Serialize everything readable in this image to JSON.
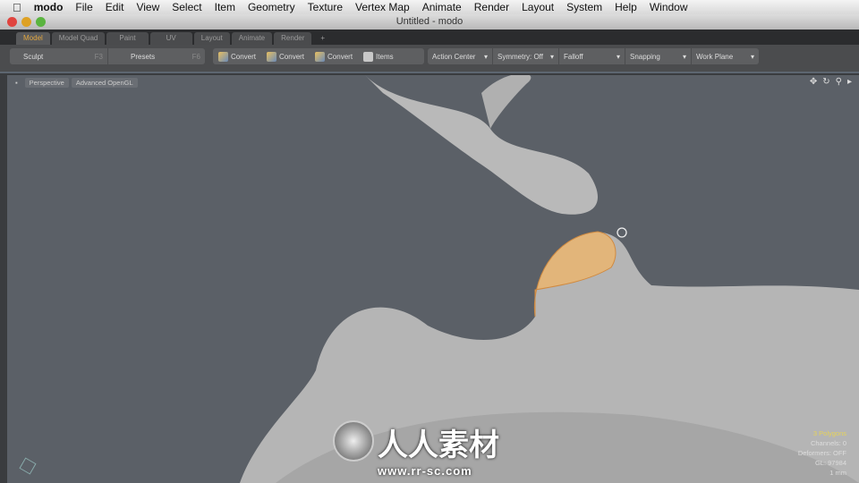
{
  "menubar": {
    "app": "modo",
    "items": [
      "File",
      "Edit",
      "View",
      "Select",
      "Item",
      "Geometry",
      "Texture",
      "Vertex Map",
      "Animate",
      "Render",
      "Layout",
      "System",
      "Help",
      "Window"
    ]
  },
  "window": {
    "title": "Untitled - modo"
  },
  "tabs": [
    {
      "label": "Model",
      "active": true
    },
    {
      "label": "Model Quad"
    },
    {
      "label": "Paint"
    },
    {
      "label": "UV"
    },
    {
      "label": "Layout"
    },
    {
      "label": "Animate"
    },
    {
      "label": "Render"
    },
    {
      "label": "+"
    }
  ],
  "toolbar": {
    "sculpt": "Sculpt",
    "sculpt_key": "F3",
    "presets": "Presets",
    "presets_key": "F6",
    "convert1": "Convert",
    "convert2": "Convert",
    "convert3": "Convert",
    "items": "Items",
    "action_center": "Action Center",
    "symmetry": "Symmetry: Off",
    "falloff": "Falloff",
    "snapping": "Snapping",
    "work_plane": "Work Plane"
  },
  "viewport": {
    "view": "Perspective",
    "shading": "Advanced OpenGL",
    "stats": {
      "polygons": "3 Polygons",
      "channels": "Channels: 0",
      "deformers": "Deformers: OFF",
      "gl": "GL: 97984",
      "unit": "1 mm"
    },
    "selection_color": "#e8b870",
    "background": "#5b6067"
  },
  "watermark": {
    "text": "人人素材",
    "url": "www.rr-sc.com"
  }
}
